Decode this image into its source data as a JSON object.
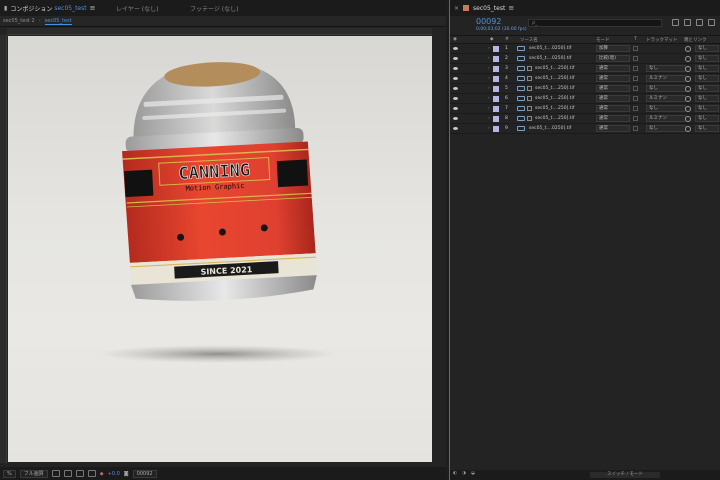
{
  "comp_panel": {
    "tab_icon": "lock-icon",
    "tab_label": "コンポジション",
    "tab_comp_name": "sec05_test",
    "layer_tab": "レイヤー (なし)",
    "footage_tab": "フッテージ (なし)",
    "breadcrumbs": [
      "sec05_test 2",
      "sec05_test"
    ],
    "footer": {
      "zoom": "%",
      "resolution": "フル画質",
      "exposure": "+0.0",
      "timecode": "00092"
    }
  },
  "artwork": {
    "brand": "CANNING",
    "tagline": "Motion Graphic",
    "since": "SINCE 2021",
    "colors": {
      "can_red": "#e0402f",
      "gold": "#d7b54a",
      "background": "#e5e4e1"
    }
  },
  "timeline": {
    "tab_label": "sec05_test",
    "timecode": "00092",
    "timecode_sub": "0;00;03;02 (30.00 fps)",
    "search_placeholder": "ρ_",
    "headers": {
      "num": "#",
      "source": "ソース名",
      "mode": "モード",
      "t": "T",
      "trkmat": "トラックマット",
      "parent": "親とリンク"
    },
    "layers": [
      {
        "num": "1",
        "name": "sec05_t....0250].tif",
        "mode": "加算",
        "trkmat": "",
        "parent": "なし",
        "fx": false
      },
      {
        "num": "2",
        "name": "sec05_t....0250].tif",
        "mode": "比較(暗)",
        "trkmat": "",
        "parent": "なし",
        "fx": false
      },
      {
        "num": "3",
        "name": "sec05_t....250].tif",
        "mode": "通常",
        "trkmat": "なし",
        "parent": "なし",
        "fx": true
      },
      {
        "num": "4",
        "name": "sec05_t....250].tif",
        "mode": "通常",
        "trkmat": "ルミナン",
        "parent": "なし",
        "fx": true
      },
      {
        "num": "5",
        "name": "sec05_t....250].tif",
        "mode": "通常",
        "trkmat": "なし",
        "parent": "なし",
        "fx": true
      },
      {
        "num": "6",
        "name": "sec05_t....250].tif",
        "mode": "通常",
        "trkmat": "ルミナン",
        "parent": "なし",
        "fx": true
      },
      {
        "num": "7",
        "name": "sec05_t....250].tif",
        "mode": "通常",
        "trkmat": "なし",
        "parent": "なし",
        "fx": true
      },
      {
        "num": "8",
        "name": "sec05_t....250].tif",
        "mode": "通常",
        "trkmat": "ルミナン",
        "parent": "なし",
        "fx": true
      },
      {
        "num": "9",
        "name": "sec05_t....0250].tif",
        "mode": "通常",
        "trkmat": "なし",
        "parent": "なし",
        "fx": false
      }
    ],
    "footer_label": "スイッチ / モード"
  }
}
